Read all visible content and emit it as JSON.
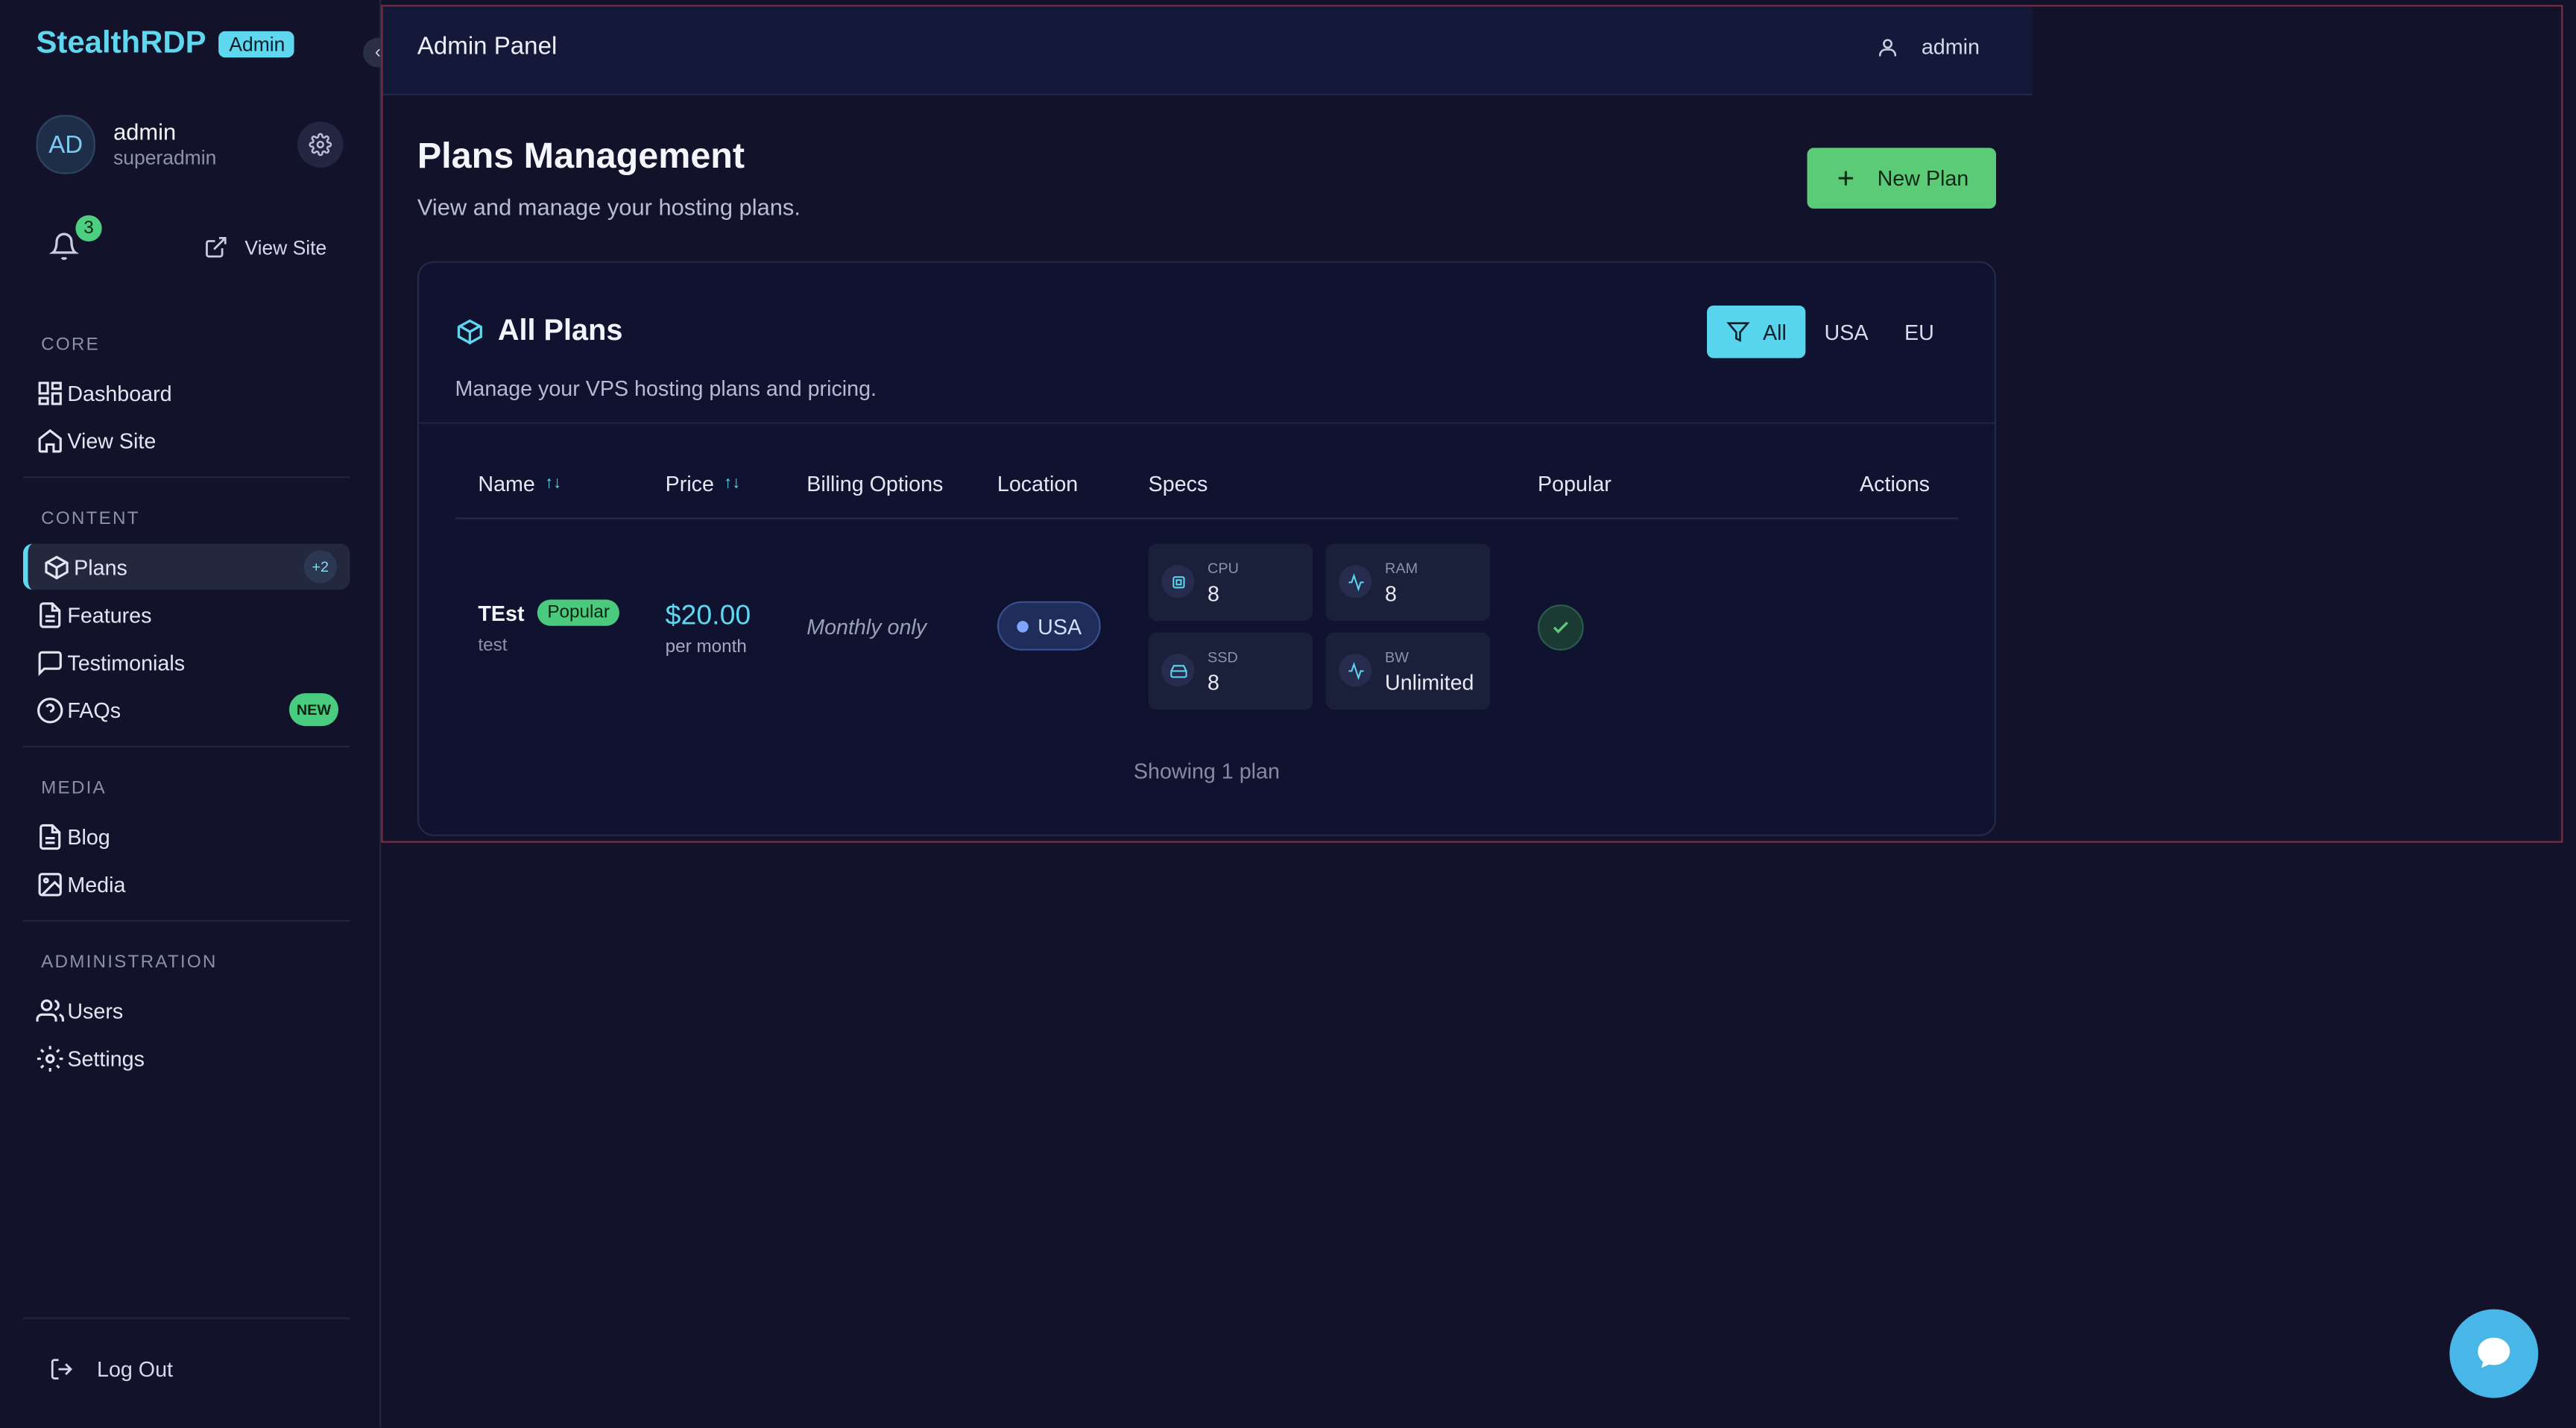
{
  "brand": {
    "name": "StealthRDP",
    "badge": "Admin"
  },
  "user": {
    "initials": "AD",
    "name": "admin",
    "role": "superadmin"
  },
  "notifications": {
    "count": "3"
  },
  "sidebar_top": {
    "view_site": "View Site"
  },
  "sections": {
    "core": "CORE",
    "content": "CONTENT",
    "media": "MEDIA",
    "administration": "ADMINISTRATION"
  },
  "nav": {
    "dashboard": "Dashboard",
    "view_site": "View Site",
    "plans": "Plans",
    "plans_badge": "+2",
    "features": "Features",
    "testimonials": "Testimonials",
    "faqs": "FAQs",
    "faqs_badge": "NEW",
    "blog": "Blog",
    "media": "Media",
    "users": "Users",
    "settings": "Settings",
    "logout": "Log Out"
  },
  "topbar": {
    "title": "Admin Panel",
    "user": "admin"
  },
  "page": {
    "title": "Plans Management",
    "subtitle": "View and manage your hosting plans.",
    "new_plan": "New Plan"
  },
  "card": {
    "title": "All Plans",
    "subtitle": "Manage your VPS hosting plans and pricing.",
    "filters": {
      "all": "All",
      "usa": "USA",
      "eu": "EU",
      "selected": "All"
    }
  },
  "table": {
    "headers": {
      "name": "Name",
      "price": "Price",
      "billing": "Billing Options",
      "location": "Location",
      "specs": "Specs",
      "popular": "Popular",
      "actions": "Actions"
    },
    "rows": [
      {
        "name": "TEst",
        "popular_tag": "Popular",
        "description": "test",
        "price": "$20.00",
        "period": "per month",
        "billing": "Monthly only",
        "location": "USA",
        "specs": {
          "cpu_label": "CPU",
          "cpu": "8",
          "ram_label": "RAM",
          "ram": "8",
          "ssd_label": "SSD",
          "ssd": "8",
          "bw_label": "BW",
          "bw": "Unlimited"
        },
        "popular": true
      }
    ],
    "footer": "Showing 1 plan"
  },
  "colors": {
    "accent": "#5fd8ef",
    "success": "#5ccb78",
    "background": "#12132a",
    "card": "#0f1330"
  },
  "icons": {
    "collapse": "chevron-left-icon",
    "settings": "gear-icon",
    "notifications": "bell-icon",
    "external": "external-link-icon",
    "plans": "package-icon",
    "filter": "filter-icon",
    "chat": "chat-bubble-icon"
  }
}
